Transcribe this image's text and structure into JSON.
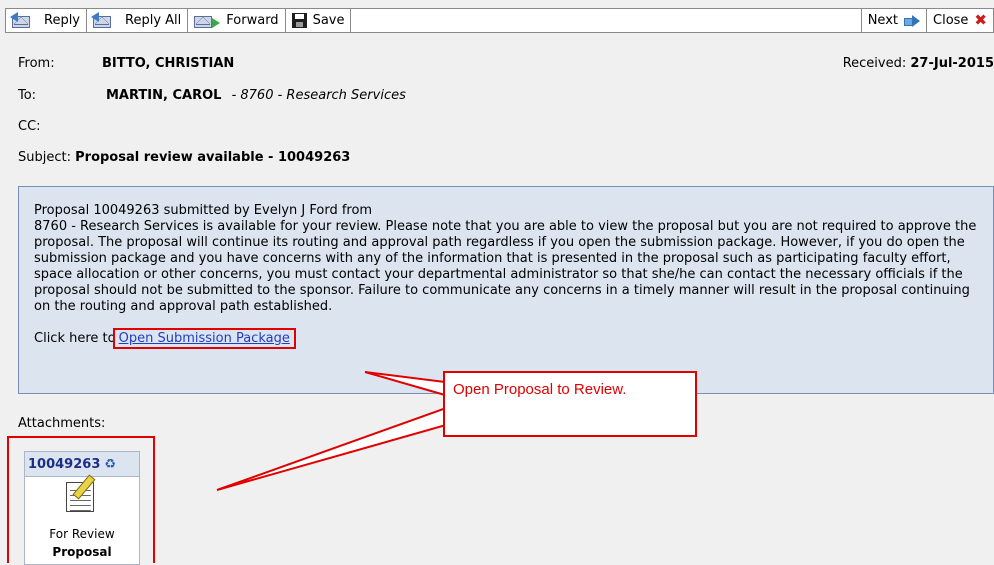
{
  "toolbar": {
    "reply": "Reply",
    "reply_all": "Reply All",
    "forward": "Forward",
    "save": "Save",
    "next": "Next",
    "close": "Close"
  },
  "header": {
    "from_label": "From:",
    "from_value": "BITTO, CHRISTIAN",
    "received_label": "Received:",
    "received_value": "27-Jul-2015",
    "to_label": "To:",
    "to_name": "MARTIN, CAROL",
    "to_dept": "- 8760 - Research Services",
    "cc_label": "CC:",
    "subject_label": "Subject:",
    "subject_value": "Proposal review available - 10049263"
  },
  "message": {
    "line1": "Proposal 10049263 submitted by Evelyn J Ford from",
    "body": "8760 - Research Services is available for your review. Please note that you are able to view the proposal but you are not required to approve the proposal. The proposal will continue its routing and approval path regardless if you open the submission package. However, if you do open the submission package and you have concerns with any of the information that is presented in the proposal such as participating faculty effort, space allocation or other concerns, you must contact your departmental administrator so that she/he can contact the necessary officials if the proposal should not be submitted to the sponsor. Failure to communicate any concerns in a timely manner will result in the proposal continuing on the routing and approval path established.",
    "click_prefix": "Click here to",
    "link_text": "Open Submission Package"
  },
  "attachments": {
    "label": "Attachments:",
    "card_id": "10049263",
    "card_line1": "For Review",
    "card_line2": "Proposal"
  },
  "annotation": {
    "callout_text": "Open Proposal to Review.",
    "color": "#e00000"
  },
  "icons": [
    "reply-icon",
    "reply-all-icon",
    "forward-icon",
    "save-icon",
    "next-arrow-icon",
    "close-icon",
    "refresh-icon",
    "document-edit-icon"
  ]
}
